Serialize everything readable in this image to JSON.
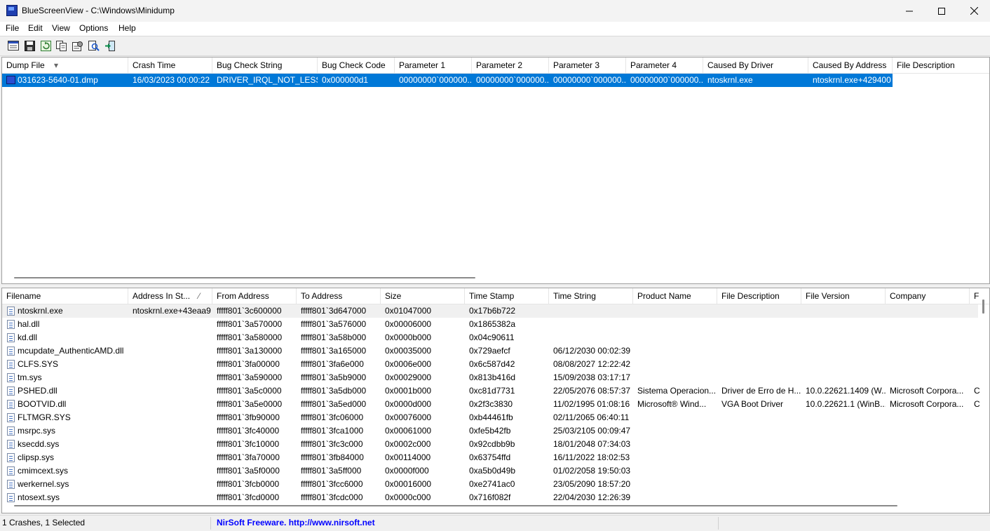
{
  "window": {
    "title": "BlueScreenView  -  C:\\Windows\\Minidump",
    "minimize_icon": "minimize-icon",
    "maximize_icon": "maximize-icon",
    "close_icon": "close-icon"
  },
  "menu": [
    "File",
    "Edit",
    "View",
    "Options",
    "Help"
  ],
  "toolbar": [
    "properties-icon",
    "save-icon",
    "refresh-icon",
    "copy-icon",
    "options-icon",
    "find-icon",
    "exit-icon"
  ],
  "top_table": {
    "columns": [
      "Dump File",
      "Crash Time",
      "Bug Check String",
      "Bug Check Code",
      "Parameter 1",
      "Parameter 2",
      "Parameter 3",
      "Parameter 4",
      "Caused By Driver",
      "Caused By Address",
      "File Description"
    ],
    "sort_indicator": "▾",
    "rows": [
      [
        "031623-5640-01.dmp",
        "16/03/2023 00:00:22",
        "DRIVER_IRQL_NOT_LESS...",
        "0x000000d1",
        "00000000`000000...",
        "00000000`000000...",
        "00000000`000000...",
        "00000000`000000...",
        "ntoskrnl.exe",
        "ntoskrnl.exe+429400",
        ""
      ]
    ]
  },
  "bottom_table": {
    "columns": [
      "Filename",
      "Address In St...",
      "From Address",
      "To Address",
      "Size",
      "Time Stamp",
      "Time String",
      "Product Name",
      "File Description",
      "File Version",
      "Company",
      "F"
    ],
    "sort_indicator": "⁄",
    "rows": [
      [
        "ntoskrnl.exe",
        "ntoskrnl.exe+43eaa9",
        "fffff801`3c600000",
        "fffff801`3d647000",
        "0x01047000",
        "0x17b6b722",
        "",
        "",
        "",
        "",
        "",
        ""
      ],
      [
        "hal.dll",
        "",
        "fffff801`3a570000",
        "fffff801`3a576000",
        "0x00006000",
        "0x1865382a",
        "",
        "",
        "",
        "",
        "",
        ""
      ],
      [
        "kd.dll",
        "",
        "fffff801`3a580000",
        "fffff801`3a58b000",
        "0x0000b000",
        "0x04c90611",
        "",
        "",
        "",
        "",
        "",
        ""
      ],
      [
        "mcupdate_AuthenticAMD.dll",
        "",
        "fffff801`3a130000",
        "fffff801`3a165000",
        "0x00035000",
        "0x729aefcf",
        "06/12/2030 00:02:39",
        "",
        "",
        "",
        "",
        ""
      ],
      [
        "CLFS.SYS",
        "",
        "fffff801`3fa00000",
        "fffff801`3fa6e000",
        "0x0006e000",
        "0x6c587d42",
        "08/08/2027 12:22:42",
        "",
        "",
        "",
        "",
        ""
      ],
      [
        "tm.sys",
        "",
        "fffff801`3a590000",
        "fffff801`3a5b9000",
        "0x00029000",
        "0x813b416d",
        "15/09/2038 03:17:17",
        "",
        "",
        "",
        "",
        ""
      ],
      [
        "PSHED.dll",
        "",
        "fffff801`3a5c0000",
        "fffff801`3a5db000",
        "0x0001b000",
        "0xc81d7731",
        "22/05/2076 08:57:37",
        "Sistema Operacion...",
        "Driver de Erro de H...",
        "10.0.22621.1409 (W...",
        "Microsoft Corpora...",
        "C"
      ],
      [
        "BOOTVID.dll",
        "",
        "fffff801`3a5e0000",
        "fffff801`3a5ed000",
        "0x0000d000",
        "0x2f3c3830",
        "11/02/1995 01:08:16",
        "Microsoft® Wind...",
        "VGA Boot Driver",
        "10.0.22621.1 (WinB...",
        "Microsoft Corpora...",
        "C"
      ],
      [
        "FLTMGR.SYS",
        "",
        "fffff801`3fb90000",
        "fffff801`3fc06000",
        "0x00076000",
        "0xb44461fb",
        "02/11/2065 06:40:11",
        "",
        "",
        "",
        "",
        ""
      ],
      [
        "msrpc.sys",
        "",
        "fffff801`3fc40000",
        "fffff801`3fca1000",
        "0x00061000",
        "0xfe5b42fb",
        "25/03/2105 00:09:47",
        "",
        "",
        "",
        "",
        ""
      ],
      [
        "ksecdd.sys",
        "",
        "fffff801`3fc10000",
        "fffff801`3fc3c000",
        "0x0002c000",
        "0x92cdbb9b",
        "18/01/2048 07:34:03",
        "",
        "",
        "",
        "",
        ""
      ],
      [
        "clipsp.sys",
        "",
        "fffff801`3fa70000",
        "fffff801`3fb84000",
        "0x00114000",
        "0x63754ffd",
        "16/11/2022 18:02:53",
        "",
        "",
        "",
        "",
        ""
      ],
      [
        "cmimcext.sys",
        "",
        "fffff801`3a5f0000",
        "fffff801`3a5ff000",
        "0x0000f000",
        "0xa5b0d49b",
        "01/02/2058 19:50:03",
        "",
        "",
        "",
        "",
        ""
      ],
      [
        "werkernel.sys",
        "",
        "fffff801`3fcb0000",
        "fffff801`3fcc6000",
        "0x00016000",
        "0xe2741ac0",
        "23/05/2090 18:57:20",
        "",
        "",
        "",
        "",
        ""
      ],
      [
        "ntosext.sys",
        "",
        "fffff801`3fcd0000",
        "fffff801`3fcdc000",
        "0x0000c000",
        "0x716f082f",
        "22/04/2030 12:26:39",
        "",
        "",
        "",
        "",
        ""
      ]
    ]
  },
  "status": {
    "left": "1 Crashes, 1 Selected",
    "center": "NirSoft Freeware.  http://www.nirsoft.net",
    "link_color": "#0000ff",
    "selection_color": "#0078d7"
  }
}
